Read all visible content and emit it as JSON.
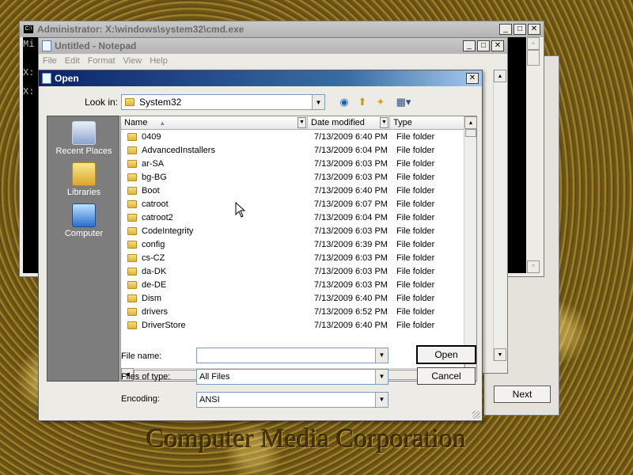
{
  "background": {
    "watermark": "Computer Media Corporation"
  },
  "cmd_window": {
    "title": "Administrator: X:\\windows\\system32\\cmd.exe",
    "icon_text": "C:\\",
    "lines": [
      "Mi",
      "X:",
      "X:"
    ],
    "buttons": {
      "minimize": "_",
      "maximize": "□",
      "close": "✕"
    }
  },
  "notepad_window": {
    "title": "Untitled - Notepad",
    "menu": [
      "File",
      "Edit",
      "Format",
      "View",
      "Help"
    ]
  },
  "wizard_window": {
    "next_label": "Next"
  },
  "open_dialog": {
    "title": "Open",
    "look_in_label": "Look in:",
    "look_in_value": "System32",
    "columns": [
      "Name",
      "Date modified",
      "Type"
    ],
    "files": [
      {
        "name": "0409",
        "date": "7/13/2009 6:40 PM",
        "type": "File folder"
      },
      {
        "name": "AdvancedInstallers",
        "date": "7/13/2009 6:04 PM",
        "type": "File folder"
      },
      {
        "name": "ar-SA",
        "date": "7/13/2009 6:03 PM",
        "type": "File folder"
      },
      {
        "name": "bg-BG",
        "date": "7/13/2009 6:03 PM",
        "type": "File folder"
      },
      {
        "name": "Boot",
        "date": "7/13/2009 6:40 PM",
        "type": "File folder"
      },
      {
        "name": "catroot",
        "date": "7/13/2009 6:07 PM",
        "type": "File folder"
      },
      {
        "name": "catroot2",
        "date": "7/13/2009 6:04 PM",
        "type": "File folder"
      },
      {
        "name": "CodeIntegrity",
        "date": "7/13/2009 6:03 PM",
        "type": "File folder"
      },
      {
        "name": "config",
        "date": "7/13/2009 6:39 PM",
        "type": "File folder"
      },
      {
        "name": "cs-CZ",
        "date": "7/13/2009 6:03 PM",
        "type": "File folder"
      },
      {
        "name": "da-DK",
        "date": "7/13/2009 6:03 PM",
        "type": "File folder"
      },
      {
        "name": "de-DE",
        "date": "7/13/2009 6:03 PM",
        "type": "File folder"
      },
      {
        "name": "Dism",
        "date": "7/13/2009 6:40 PM",
        "type": "File folder"
      },
      {
        "name": "drivers",
        "date": "7/13/2009 6:52 PM",
        "type": "File folder"
      },
      {
        "name": "DriverStore",
        "date": "7/13/2009 6:40 PM",
        "type": "File folder"
      }
    ],
    "places": [
      {
        "label": "Recent Places",
        "icon": "recent-places-icon"
      },
      {
        "label": "Libraries",
        "icon": "libraries-icon"
      },
      {
        "label": "Computer",
        "icon": "computer-icon"
      }
    ],
    "file_name_label": "File name:",
    "file_name_value": "",
    "file_type_label": "Files of type:",
    "file_type_value": "All Files",
    "encoding_label": "Encoding:",
    "encoding_value": "ANSI",
    "open_label": "Open",
    "cancel_label": "Cancel"
  }
}
